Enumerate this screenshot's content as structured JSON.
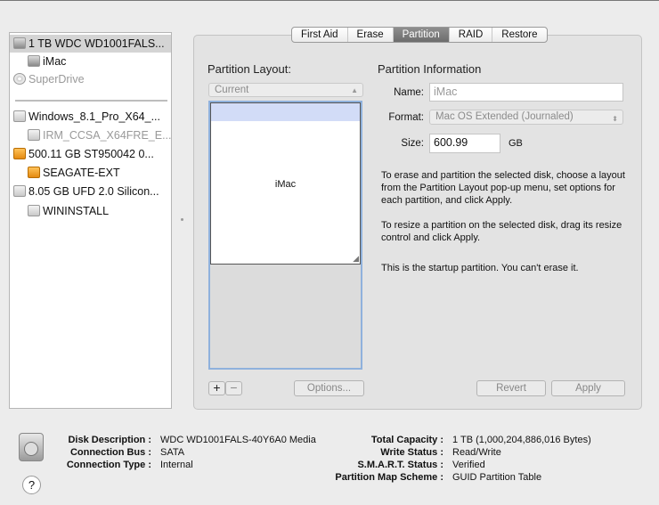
{
  "sidebar": {
    "items": [
      {
        "label": "1 TB WDC WD1001FALS...",
        "icon": "hard-disk-icon",
        "selected": true
      },
      {
        "label": "iMac",
        "icon": "volume-icon"
      },
      {
        "label": "SuperDrive",
        "icon": "optical-drive-icon"
      },
      {
        "label": "Windows_8.1_Pro_X64_...",
        "icon": "disk-image-icon"
      },
      {
        "label": "IRM_CCSA_X64FRE_E...",
        "icon": "volume-icon"
      },
      {
        "label": "500.11 GB ST950042 0...",
        "icon": "external-disk-icon"
      },
      {
        "label": "SEAGATE-EXT",
        "icon": "external-volume-icon"
      },
      {
        "label": "8.05 GB UFD 2.0 Silicon...",
        "icon": "usb-disk-icon"
      },
      {
        "label": "WININSTALL",
        "icon": "volume-icon"
      }
    ]
  },
  "tabs": [
    "First Aid",
    "Erase",
    "Partition",
    "RAID",
    "Restore"
  ],
  "active_tab": "Partition",
  "layout": {
    "title": "Partition Layout:",
    "popup": "Current",
    "partition_name": "iMac",
    "add": "+",
    "remove": "−",
    "options": "Options..."
  },
  "info": {
    "title": "Partition Information",
    "name_label": "Name:",
    "name_value": "iMac",
    "format_label": "Format:",
    "format_value": "Mac OS Extended (Journaled)",
    "size_label": "Size:",
    "size_value": "600.99",
    "size_unit": "GB",
    "desc1": "To erase and partition the selected disk, choose a layout from the Partition Layout pop-up menu, set options for each partition, and click Apply.",
    "desc2": "To resize a partition on the selected disk, drag its resize control and click Apply.",
    "desc3": "This is the startup partition. You can't erase it.",
    "revert": "Revert",
    "apply": "Apply"
  },
  "details": {
    "left": [
      {
        "k": "Disk Description :",
        "v": "WDC WD1001FALS-40Y6A0 Media"
      },
      {
        "k": "Connection Bus :",
        "v": "SATA"
      },
      {
        "k": "Connection Type :",
        "v": "Internal"
      }
    ],
    "right": [
      {
        "k": "Total Capacity :",
        "v": "1 TB (1,000,204,886,016 Bytes)"
      },
      {
        "k": "Write Status :",
        "v": "Read/Write"
      },
      {
        "k": "S.M.A.R.T. Status :",
        "v": "Verified"
      },
      {
        "k": "Partition Map Scheme :",
        "v": "GUID Partition Table"
      }
    ]
  },
  "help": "?"
}
